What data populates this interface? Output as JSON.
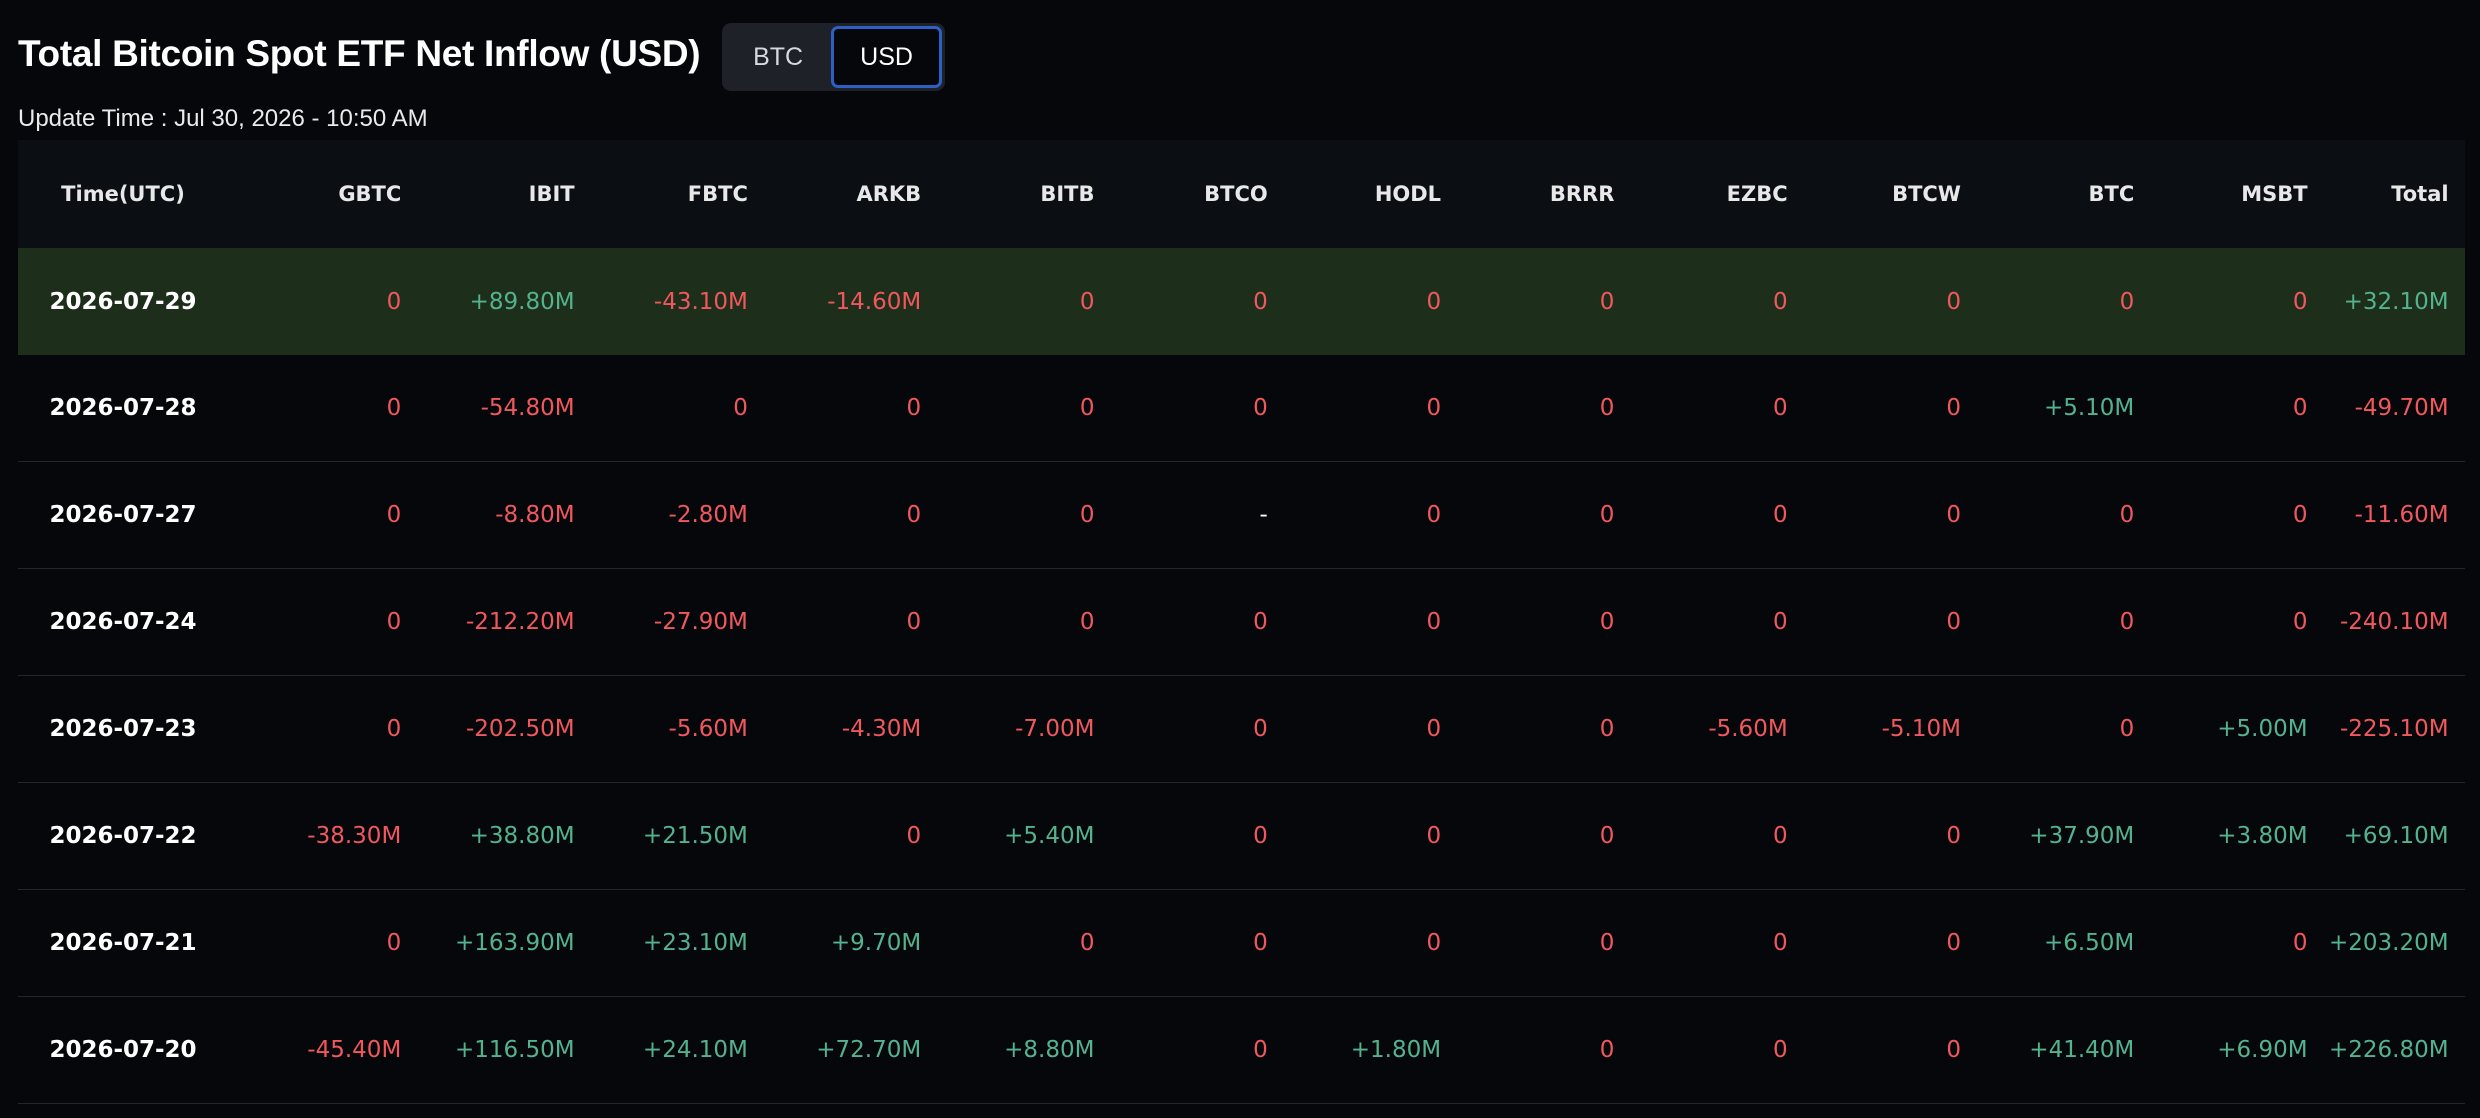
{
  "header": {
    "title": "Total Bitcoin Spot ETF Net Inflow (USD)",
    "toggle": [
      {
        "label": "BTC",
        "active": false
      },
      {
        "label": "USD",
        "active": true
      }
    ],
    "update_time": "Update Time : Jul 30, 2026 - 10:50 AM"
  },
  "table": {
    "columns": [
      "Time(UTC)",
      "GBTC",
      "IBIT",
      "FBTC",
      "ARKB",
      "BITB",
      "BTCO",
      "HODL",
      "BRRR",
      "EZBC",
      "BTCW",
      "BTC",
      "MSBT",
      "Total"
    ],
    "rows": [
      {
        "date": "2026-07-29",
        "highlight": true,
        "values": [
          "0",
          "+89.80M",
          "-43.10M",
          "-14.60M",
          "0",
          "0",
          "0",
          "0",
          "0",
          "0",
          "0",
          "0",
          "+32.10M"
        ]
      },
      {
        "date": "2026-07-28",
        "highlight": false,
        "values": [
          "0",
          "-54.80M",
          "0",
          "0",
          "0",
          "0",
          "0",
          "0",
          "0",
          "0",
          "+5.10M",
          "0",
          "-49.70M"
        ]
      },
      {
        "date": "2026-07-27",
        "highlight": false,
        "values": [
          "0",
          "-8.80M",
          "-2.80M",
          "0",
          "0",
          "-",
          "0",
          "0",
          "0",
          "0",
          "0",
          "0",
          "-11.60M"
        ]
      },
      {
        "date": "2026-07-24",
        "highlight": false,
        "values": [
          "0",
          "-212.20M",
          "-27.90M",
          "0",
          "0",
          "0",
          "0",
          "0",
          "0",
          "0",
          "0",
          "0",
          "-240.10M"
        ]
      },
      {
        "date": "2026-07-23",
        "highlight": false,
        "values": [
          "0",
          "-202.50M",
          "-5.60M",
          "-4.30M",
          "-7.00M",
          "0",
          "0",
          "0",
          "-5.60M",
          "-5.10M",
          "0",
          "+5.00M",
          "-225.10M"
        ]
      },
      {
        "date": "2026-07-22",
        "highlight": false,
        "values": [
          "-38.30M",
          "+38.80M",
          "+21.50M",
          "0",
          "+5.40M",
          "0",
          "0",
          "0",
          "0",
          "0",
          "+37.90M",
          "+3.80M",
          "+69.10M"
        ]
      },
      {
        "date": "2026-07-21",
        "highlight": false,
        "values": [
          "0",
          "+163.90M",
          "+23.10M",
          "+9.70M",
          "0",
          "0",
          "0",
          "0",
          "0",
          "0",
          "+6.50M",
          "0",
          "+203.20M"
        ]
      },
      {
        "date": "2026-07-20",
        "highlight": false,
        "values": [
          "-45.40M",
          "+116.50M",
          "+24.10M",
          "+72.70M",
          "+8.80M",
          "0",
          "+1.80M",
          "0",
          "0",
          "0",
          "+41.40M",
          "+6.90M",
          "+226.80M"
        ]
      }
    ]
  },
  "colors": {
    "negative": "#f0585e",
    "positive": "#54b38e",
    "neutral": "#ffffff",
    "highlight_row": "#1d2e1a",
    "toggle_active_border": "#2e5fc4"
  }
}
